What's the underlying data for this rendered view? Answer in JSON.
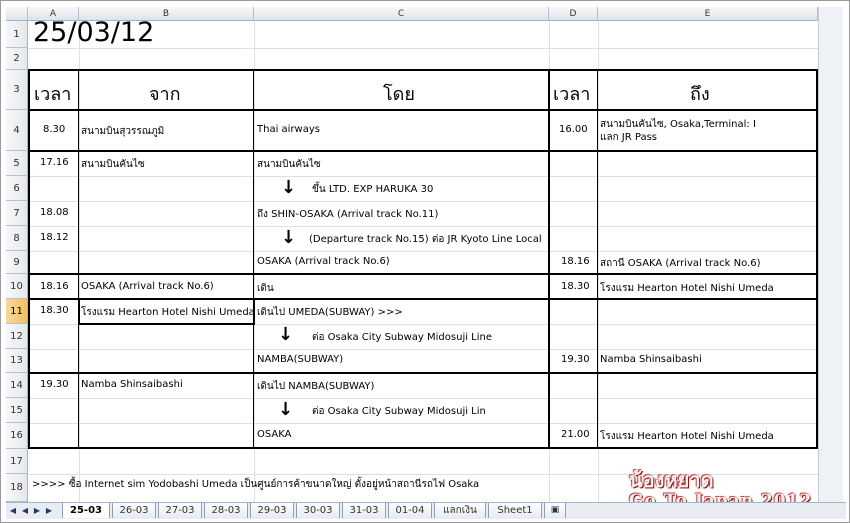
{
  "sheet": {
    "date_cell": "25/03/12",
    "column_letters": [
      "A",
      "B",
      "C",
      "D",
      "E"
    ],
    "row_numbers": [
      "1",
      "2",
      "3",
      "4",
      "5",
      "6",
      "7",
      "8",
      "9",
      "10",
      "11",
      "12",
      "13",
      "14",
      "15",
      "16",
      "17",
      "18"
    ],
    "headers": {
      "time1": "เวลา",
      "from": "จาก",
      "by": "โดย",
      "time2": "เวลา",
      "to": "ถึง"
    },
    "rows": {
      "r4": {
        "a": "8.30",
        "b": "สนามบินสุวรรณภูมิ",
        "c": "Thai airways",
        "d": "16.00",
        "e1": "สนามบินคันไซ, Osaka,Terminal: I",
        "e2": "แลก JR Pass"
      },
      "r5": {
        "a": "17.16",
        "b": "สนามบินคันไซ",
        "c": "สนามบินคันไซ"
      },
      "r6": {
        "c": "ขึ้น LTD. EXP HARUKA 30"
      },
      "r7": {
        "a": "18.08",
        "c": "ถึง SHIN-OSAKA (Arrival track No.11)"
      },
      "r8": {
        "a": "18.12",
        "c": "(Departure track No.15) ต่อ JR Kyoto Line Local"
      },
      "r9": {
        "c": "OSAKA (Arrival track No.6)",
        "d": "18.16",
        "e": "สถานี OSAKA (Arrival track No.6)"
      },
      "r10": {
        "a": "18.16",
        "b": "OSAKA (Arrival track No.6)",
        "c": "เดิน",
        "d": "18.30",
        "e": "โรงแรม Hearton Hotel Nishi Umeda"
      },
      "r11": {
        "a": "18.30",
        "b": "โรงแรม Hearton Hotel Nishi Umeda",
        "c": "เดินไป UMEDA(SUBWAY) >>>"
      },
      "r12": {
        "c": "ต่อ Osaka City Subway Midosuji Line"
      },
      "r13": {
        "c": "NAMBA(SUBWAY)",
        "d": "19.30",
        "e": "Namba Shinsaibashi"
      },
      "r14": {
        "a": "19.30",
        "b": "Namba Shinsaibashi",
        "c": "เดินไป NAMBA(SUBWAY)"
      },
      "r15": {
        "c": "ต่อ Osaka City Subway Midosuji Lin"
      },
      "r16": {
        "c": "OSAKA",
        "d": "21.00",
        "e": "โรงแรม Hearton Hotel Nishi Umeda"
      },
      "r18": {
        "a": ">>>> ซื้อ Internet sim Yodobashi Umeda เป็นศูนย์การค้าขนาดใหญ่ ตั้งอยู่หน้าสถานีรถไฟ Osaka"
      }
    },
    "arrow_glyph": "↓"
  },
  "tabs": [
    "25-03",
    "26-03",
    "27-03",
    "28-03",
    "29-03",
    "30-03",
    "31-03",
    "01-04",
    "แลกเงิน",
    "Sheet1"
  ],
  "active_tab": "25-03",
  "watermark": {
    "line1": "น้องหยาด",
    "line2": "Go To Japan 2012"
  }
}
